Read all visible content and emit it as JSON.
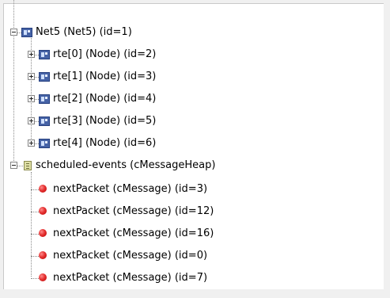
{
  "tree": {
    "root": {
      "label": "Net5 (Net5) (id=1)",
      "icon": "network-icon",
      "children": [
        {
          "label": "rte[0] (Node) (id=2)",
          "icon": "node-icon"
        },
        {
          "label": "rte[1] (Node) (id=3)",
          "icon": "node-icon"
        },
        {
          "label": "rte[2] (Node) (id=4)",
          "icon": "node-icon"
        },
        {
          "label": "rte[3] (Node) (id=5)",
          "icon": "node-icon"
        },
        {
          "label": "rte[4] (Node) (id=6)",
          "icon": "node-icon"
        }
      ]
    },
    "scheduled": {
      "label": "scheduled-events (cMessageHeap)",
      "icon": "message-heap-icon",
      "children": [
        {
          "label": "nextPacket (cMessage) (id=3)",
          "icon": "message-icon"
        },
        {
          "label": "nextPacket (cMessage) (id=12)",
          "icon": "message-icon"
        },
        {
          "label": "nextPacket (cMessage) (id=16)",
          "icon": "message-icon"
        },
        {
          "label": "nextPacket (cMessage) (id=0)",
          "icon": "message-icon"
        },
        {
          "label": "nextPacket (cMessage) (id=7)",
          "icon": "message-icon"
        }
      ]
    }
  }
}
